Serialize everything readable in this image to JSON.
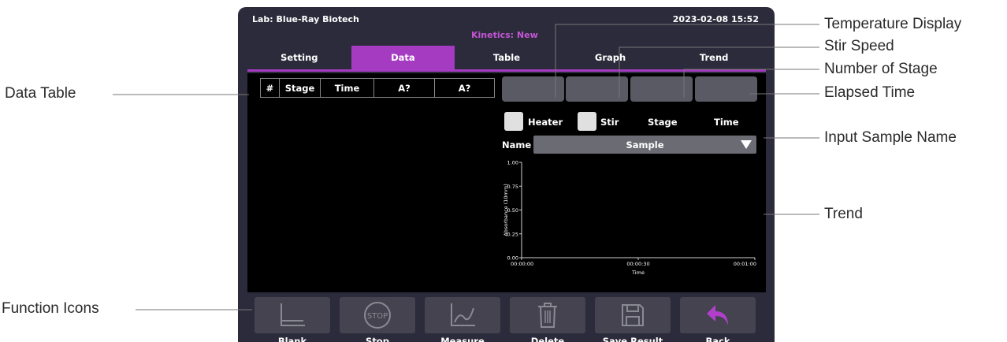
{
  "header": {
    "lab": "Lab: Blue-Ray Biotech",
    "datetime": "2023-02-08 15:52",
    "mode": "Kinetics: New"
  },
  "tabs": [
    {
      "label": "Setting",
      "active": false
    },
    {
      "label": "Data",
      "active": true
    },
    {
      "label": "Table",
      "active": false
    },
    {
      "label": "Graph",
      "active": false
    },
    {
      "label": "Trend",
      "active": false
    }
  ],
  "data_table": {
    "headers": [
      "#",
      "Stage",
      "Time",
      "A?",
      "A?"
    ]
  },
  "status_labels": {
    "heater": "Heater",
    "stir": "Stir",
    "stage": "Stage",
    "time": "Time"
  },
  "sample": {
    "label": "Name",
    "value": "Sample"
  },
  "chart_data": {
    "type": "line",
    "ylabel": "Absorbance (10mm)",
    "xlabel": "Time",
    "y_ticks": [
      "0.00",
      "0.25",
      "0.50",
      "0.75",
      "1.00"
    ],
    "x_ticks": [
      "00:00:00",
      "00:00:30",
      "00:01:00"
    ],
    "ylim": [
      0,
      1
    ],
    "series": []
  },
  "functions": [
    {
      "label": "Blank",
      "icon": "blank-icon"
    },
    {
      "label": "Stop",
      "icon": "stop-icon",
      "icon_text": "STOP"
    },
    {
      "label": "Measure",
      "icon": "measure-icon"
    },
    {
      "label": "Delete",
      "icon": "trash-icon"
    },
    {
      "label": "Save Result",
      "icon": "save-icon"
    },
    {
      "label": "Back",
      "icon": "back-arrow-icon"
    }
  ],
  "annotations": {
    "temperature_display": "Temperature Display",
    "stir_speed": "Stir Speed",
    "number_of_stage": "Number of Stage",
    "elapsed_time": "Elapsed Time",
    "input_sample_name": "Input Sample Name",
    "trend": "Trend",
    "data_table": "Data Table",
    "function_icons": "Function Icons"
  },
  "colors": {
    "panel": "#2c2b3b",
    "accent": "#a43bc0",
    "mode_text": "#c455d6",
    "button": "#44434f",
    "back_arrow": "#b13fcc"
  }
}
